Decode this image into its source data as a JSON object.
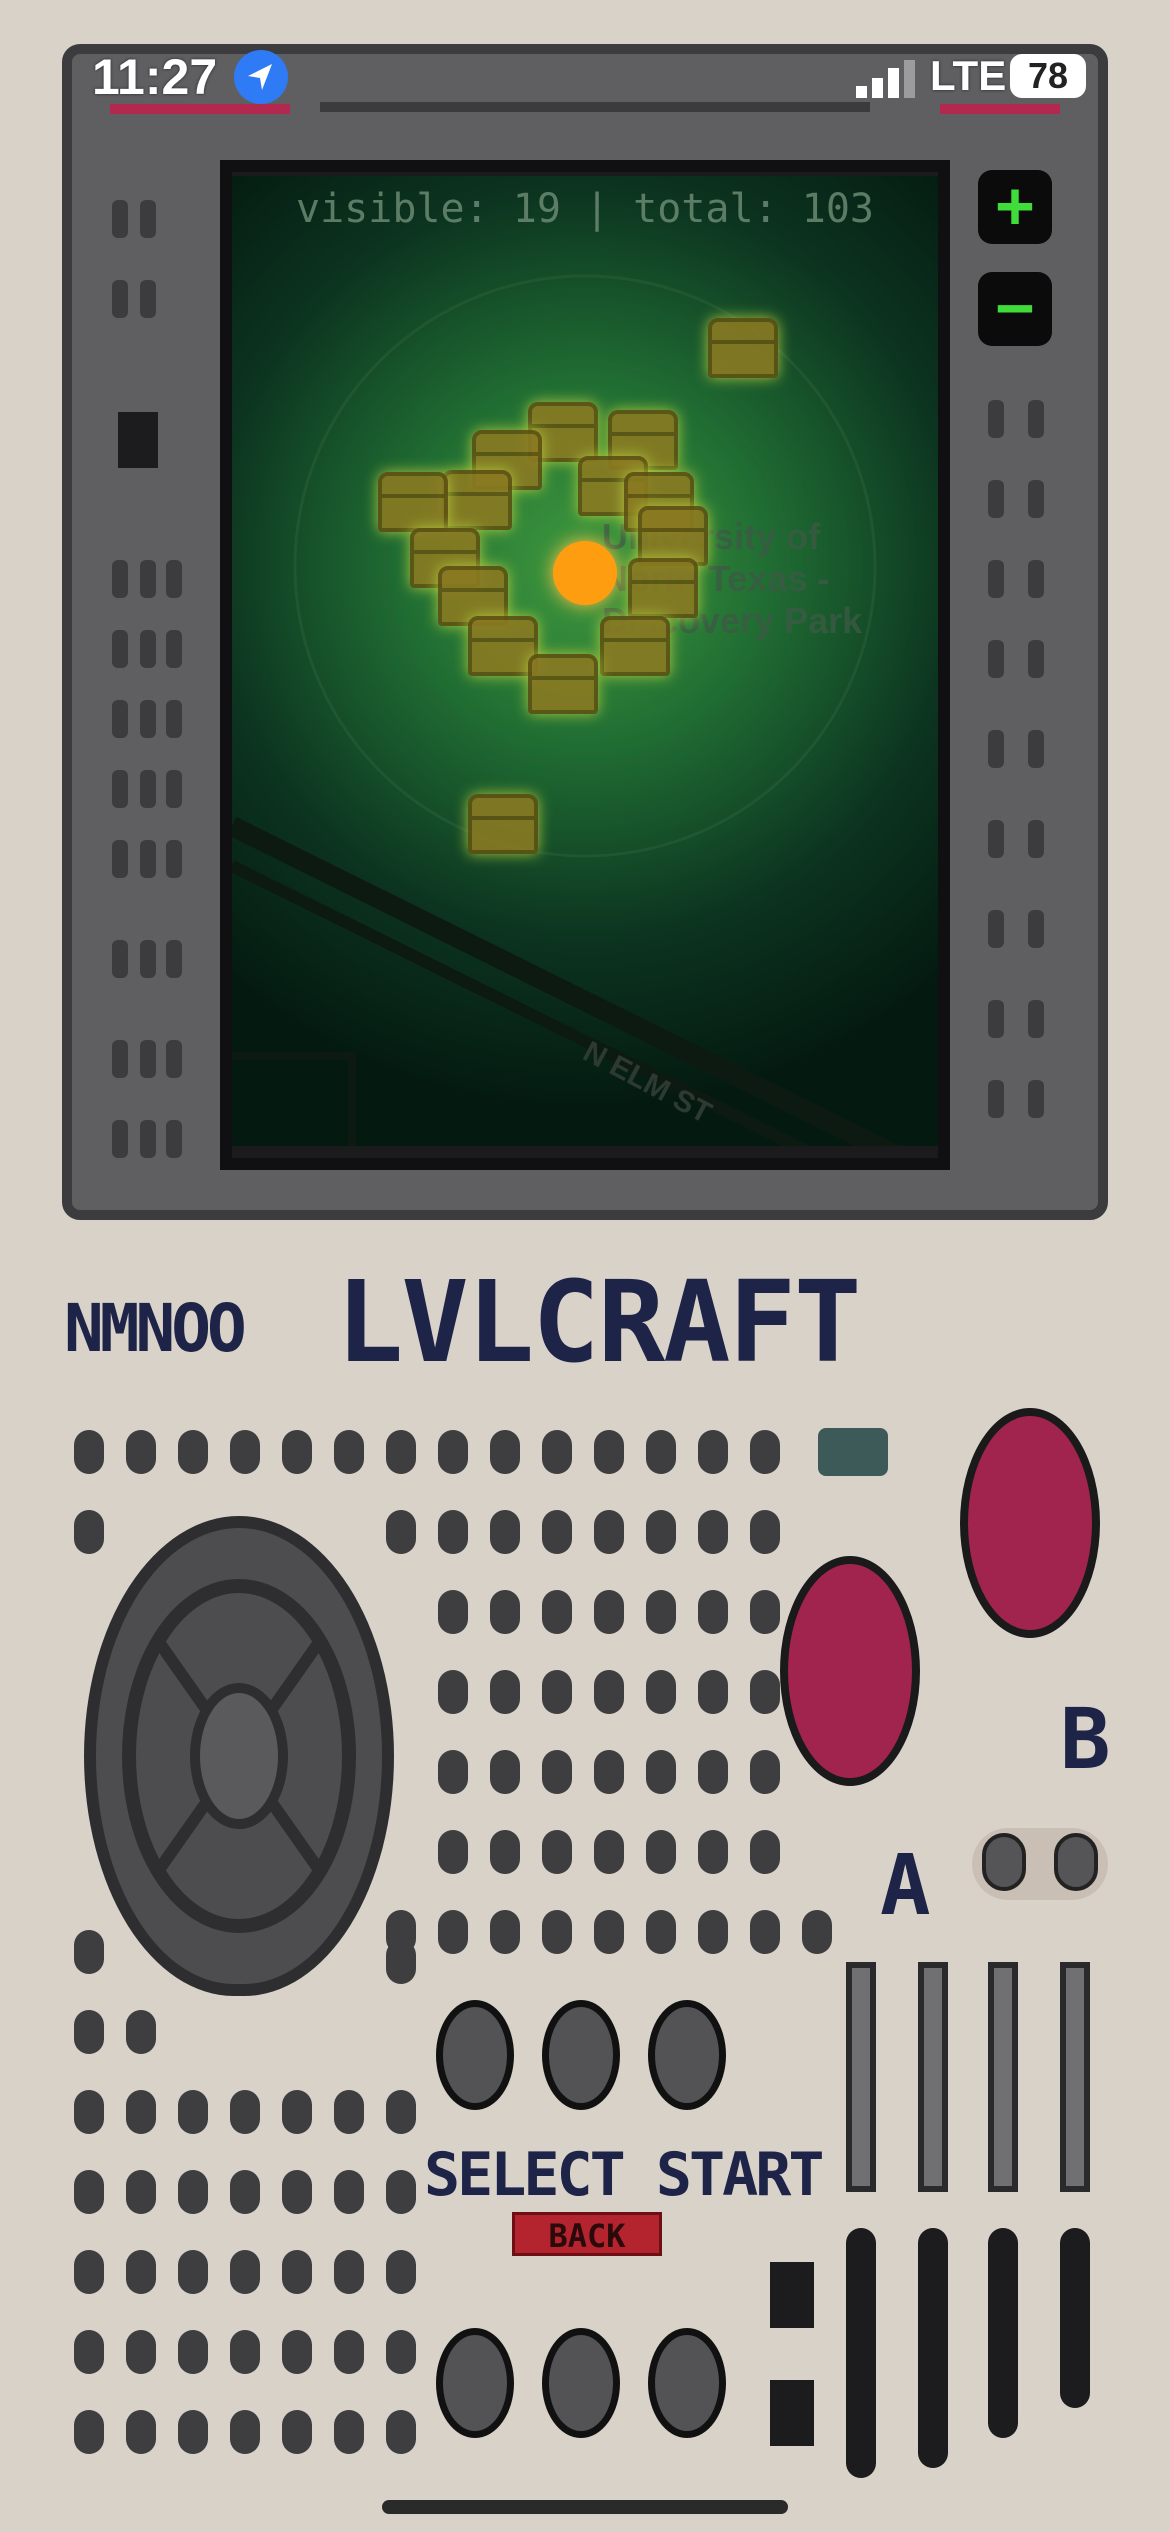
{
  "status_bar": {
    "time": "11:27",
    "network": "LTE",
    "battery": "78",
    "location_icon": "location-arrow-icon",
    "signal_icon": "cellular-signal-icon"
  },
  "map": {
    "counter_text": "visible: 19 | total: 103",
    "place_label_line1": "University of",
    "place_label_line2": "North Texas -",
    "place_label_line3": "Discovery Park",
    "street_label": "N ELM ST",
    "player_color": "#ff9d10",
    "chest_icon": "treasure-chest-icon"
  },
  "zoom": {
    "in_label": "+",
    "out_label": "−"
  },
  "brand": {
    "small": "NMNOO",
    "title": "LVLCRAFT"
  },
  "controls": {
    "a_label": "A",
    "b_label": "B",
    "select_start_label": "SELECT START",
    "back_label": "BACK",
    "button_color": "#a0244e"
  }
}
